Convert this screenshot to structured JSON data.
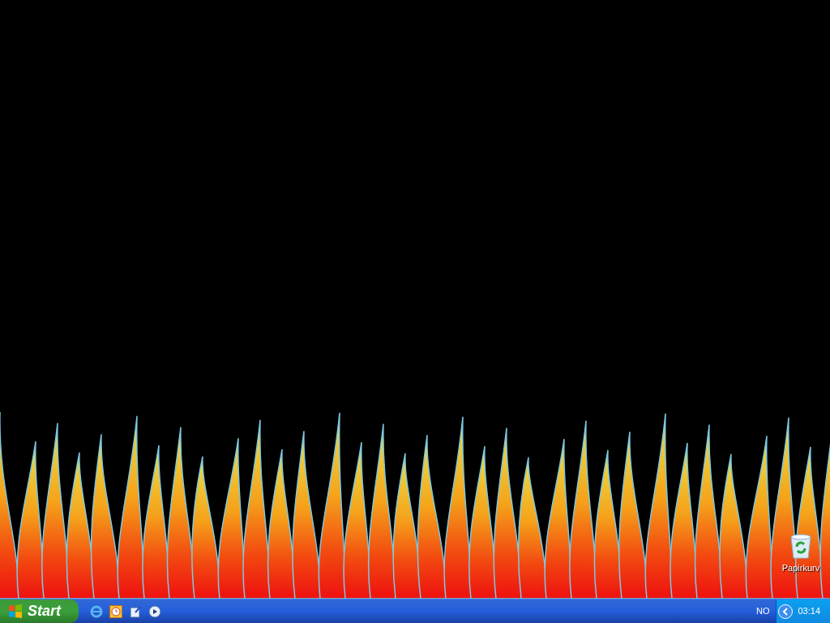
{
  "desktop": {
    "icons": [
      {
        "label": "Papirkurv"
      }
    ]
  },
  "taskbar": {
    "start_button": "Start",
    "tray": {
      "language": "NO",
      "clock": "03:14"
    }
  }
}
